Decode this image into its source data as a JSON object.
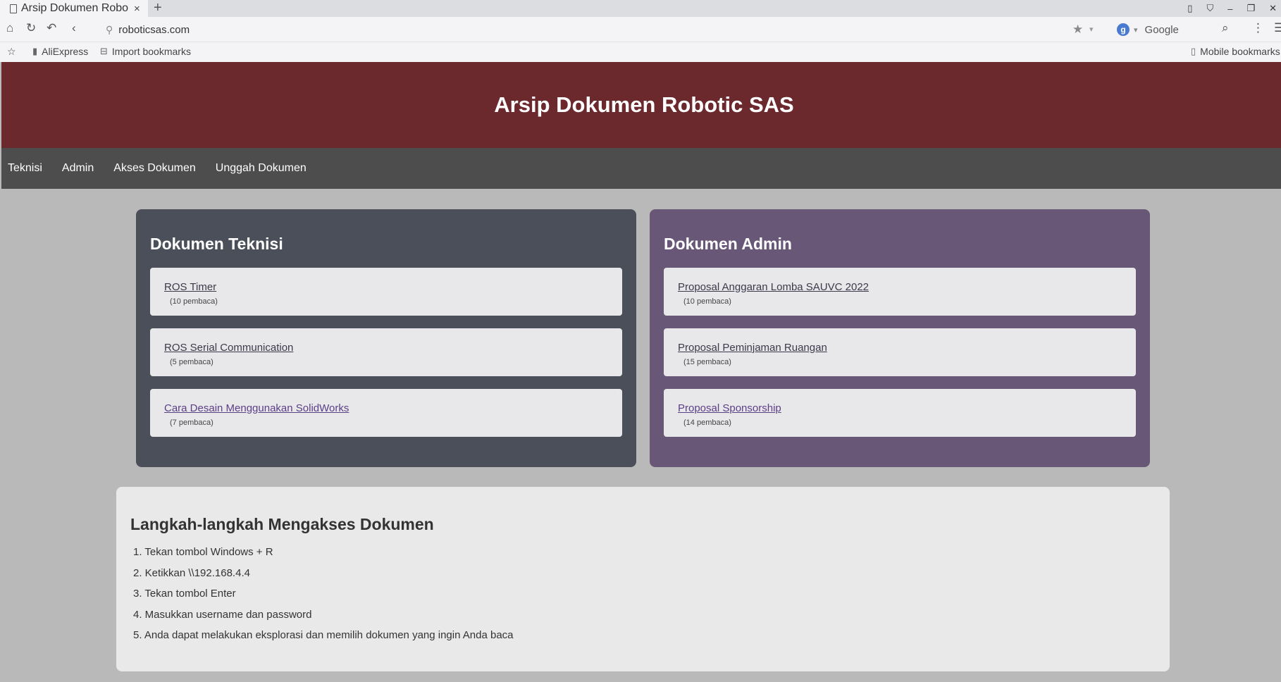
{
  "browser": {
    "tab_title": "Arsip Dokumen Robotic SAS",
    "tab_close": "×",
    "new_tab": "+",
    "url": "roboticsas.com",
    "search_engine": "Google",
    "bookmarks": [
      "AliExpress",
      "Import bookmarks"
    ],
    "mobile_bookmarks": "Mobile bookmarks"
  },
  "header": {
    "title": "Arsip Dokumen Robotic SAS",
    "background": "#6b292d"
  },
  "nav": {
    "items": [
      "Teknisi",
      "Admin",
      "Akses Dokumen",
      "Unggah Dokumen"
    ]
  },
  "teknisi": {
    "heading": "Dokumen Teknisi",
    "background": "#4a4f59",
    "docs": [
      {
        "title": "ROS Timer",
        "readers": "(10 pembaca)"
      },
      {
        "title": "ROS Serial Communication",
        "readers": "(5 pembaca)"
      },
      {
        "title": "Cara Desain Menggunakan SolidWorks",
        "readers": "(7 pembaca)"
      }
    ]
  },
  "admin": {
    "heading": "Dokumen Admin",
    "background": "#695778",
    "docs": [
      {
        "title": "Proposal Anggaran Lomba SAUVC 2022",
        "readers": "(10 pembaca)"
      },
      {
        "title": "Proposal Peminjaman Ruangan",
        "readers": "(15 pembaca)"
      },
      {
        "title": "Proposal Sponsorship",
        "readers": "(14 pembaca)"
      }
    ]
  },
  "steps": {
    "heading": "Langkah-langkah Mengakses Dokumen",
    "items": [
      "1. Tekan tombol Windows + R",
      "2. Ketikkan \\\\192.168.4.4",
      "3. Tekan tombol Enter",
      "4. Masukkan username dan password",
      "5. Anda dapat melakukan eksplorasi dan memilih dokumen yang ingin Anda baca"
    ]
  }
}
